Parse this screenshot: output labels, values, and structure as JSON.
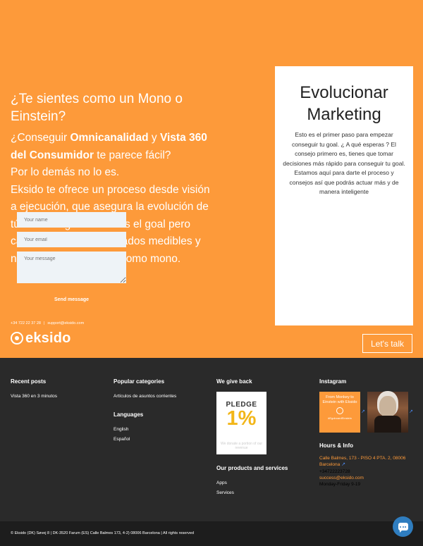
{
  "hero": {
    "heading": "¿Te sientes como un Mono o Einstein?",
    "body_pre": "¿Conseguir ",
    "body_bold1": "Omnicanalidad",
    "body_mid1": " y ",
    "body_bold2": "Vista 360 del Consumidor",
    "body_post": " te parece fácil?",
    "line2": "Por lo demás no lo es.",
    "line3": "Eksido te ofrece un proceso desde visión a ejecución, que asegura la evolución de tú marketing. Einstein es el goal pero cada día tendrás resultados medibles y nunca más te sentirás como mono.",
    "phone": "+34 722 22 37 28",
    "email": "support@eksido.com",
    "logo_text": "eksido",
    "lets_talk": "Let's talk"
  },
  "contact_form": {
    "title": "Evolucionar Marketing",
    "description": "Esto es el primer paso para empezar conseguir tu goal. ¿ A qué esperas ? El consejo primero es, tienes que tomar decisiones más rápido para conseguir tu goal. Estamos aquí para darte el proceso y consejos así que podrás actuar más y de manera inteligente",
    "name_placeholder": "Your name",
    "email_placeholder": "Your email",
    "message_placeholder": "Your message",
    "send_label": "Send message"
  },
  "footer": {
    "recent_posts": {
      "title": "Recent posts",
      "items": [
        "Vista 360 en 3 minutos"
      ]
    },
    "popular_categories": {
      "title": "Popular categories",
      "items": [
        "Artículos de asuntos corrientes"
      ]
    },
    "languages": {
      "title": "Languages",
      "items": [
        "English",
        "Español"
      ]
    },
    "we_give_back": {
      "title": "We give back",
      "pledge_title": "PLEDGE",
      "pledge_number": "1%",
      "pledge_sub": "We donate a portion of our revenue"
    },
    "products": {
      "title": "Our products and services",
      "items": [
        "Apps",
        "Services"
      ]
    },
    "instagram": {
      "title": "Instagram",
      "post1_text": "From Monkey to Einstein with Eksido",
      "post1_small": "#EgoboardEinstein"
    },
    "hours": {
      "title": "Hours & Info",
      "address": "Calle Balmes, 173 - PISO 4 PTA. 2, 08006 Barcelona",
      "phone": "+34722223728",
      "email": "success@eksido.com",
      "hours": "Monday-Friday 9-19"
    }
  },
  "copyright": "© Eksido (DK) Søvej 8 | DK-3520 Farum (ES) Calle Balmes 173, 4-2) 08006 Barcelona | All rights reserved"
}
